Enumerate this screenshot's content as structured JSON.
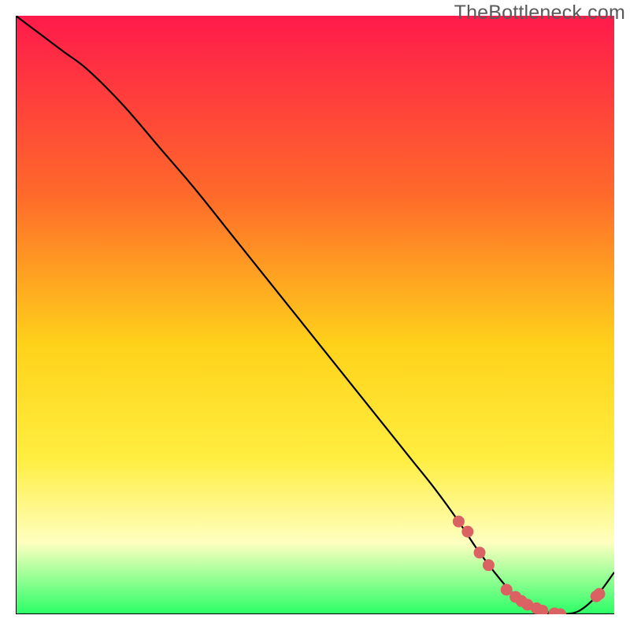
{
  "watermark": "TheBottleneck.com",
  "colors": {
    "gradient_top": "#ff1a4b",
    "gradient_mid_upper": "#ff6a2a",
    "gradient_mid": "#ffd21a",
    "gradient_mid_lower": "#ffee40",
    "gradient_pale_yellow": "#ffffc0",
    "gradient_bottom": "#2aff66",
    "curve": "#000000",
    "marker_fill": "#da6262",
    "axis": "#000000"
  },
  "chart_data": {
    "type": "line",
    "title": "",
    "xlabel": "",
    "ylabel": "",
    "xlim": [
      0,
      100
    ],
    "ylim": [
      0,
      100
    ],
    "series": [
      {
        "name": "bottleneck-curve",
        "x": [
          0,
          4,
          8,
          12,
          18,
          24,
          30,
          36,
          42,
          48,
          54,
          60,
          66,
          70,
          74,
          77,
          80,
          83,
          86,
          89,
          91,
          94,
          97,
          100
        ],
        "y": [
          100,
          97,
          94,
          91,
          85,
          78,
          71,
          63.5,
          56,
          48.5,
          41,
          33.5,
          26,
          21,
          15.5,
          11,
          7,
          3.5,
          1.2,
          0.3,
          0,
          0.5,
          3,
          7
        ]
      }
    ],
    "markers": {
      "name": "highlight-points",
      "x": [
        74,
        75.5,
        77.5,
        79,
        82,
        83.5,
        84.5,
        85.5,
        87,
        88,
        90,
        91,
        97,
        97.5
      ],
      "y": [
        15.5,
        13.8,
        10.3,
        8.2,
        4.1,
        2.9,
        2.2,
        1.6,
        1.0,
        0.6,
        0.15,
        0.0,
        3.0,
        3.4
      ]
    }
  }
}
